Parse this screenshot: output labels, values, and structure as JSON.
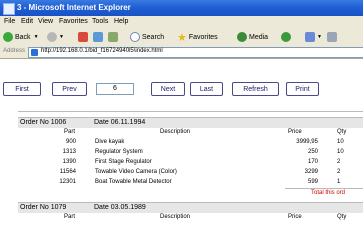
{
  "window": {
    "title": "3 - Microsoft Internet Explorer"
  },
  "menu": [
    "File",
    "Edit",
    "View",
    "Favorites",
    "Tools",
    "Help"
  ],
  "toolbar": {
    "back": "Back",
    "search": "Search",
    "favorites": "Favorites",
    "media": "Media"
  },
  "address": {
    "label": "Address",
    "url": "http://192.168.0.1/bid_f16724940l5\\index.html"
  },
  "pager": {
    "first": "First",
    "prev": "Prev",
    "page": "6",
    "next": "Next",
    "last": "Last",
    "refresh": "Refresh",
    "print": "Print"
  },
  "columns": {
    "part": "Part",
    "description": "Description",
    "price": "Price",
    "qty": "Qty"
  },
  "orders": [
    {
      "number": "Order No 1006",
      "date": "Date 06.11.1994",
      "items": [
        {
          "part": "900",
          "description": "Dive kayak",
          "price": "3999,95",
          "qty": "10"
        },
        {
          "part": "1313",
          "description": "Regulator System",
          "price": "250",
          "qty": "10"
        },
        {
          "part": "1390",
          "description": "First Stage Regulator",
          "price": "170",
          "qty": "2"
        },
        {
          "part": "11564",
          "description": "Towable Video Camera (Color)",
          "price": "3299",
          "qty": "2"
        },
        {
          "part": "12301",
          "description": "Boat Towable Metal Detector",
          "price": "599",
          "qty": "1"
        }
      ],
      "total_label": "Total this ord"
    },
    {
      "number": "Order No 1079",
      "date": "Date 03.05.1989",
      "items": []
    }
  ]
}
